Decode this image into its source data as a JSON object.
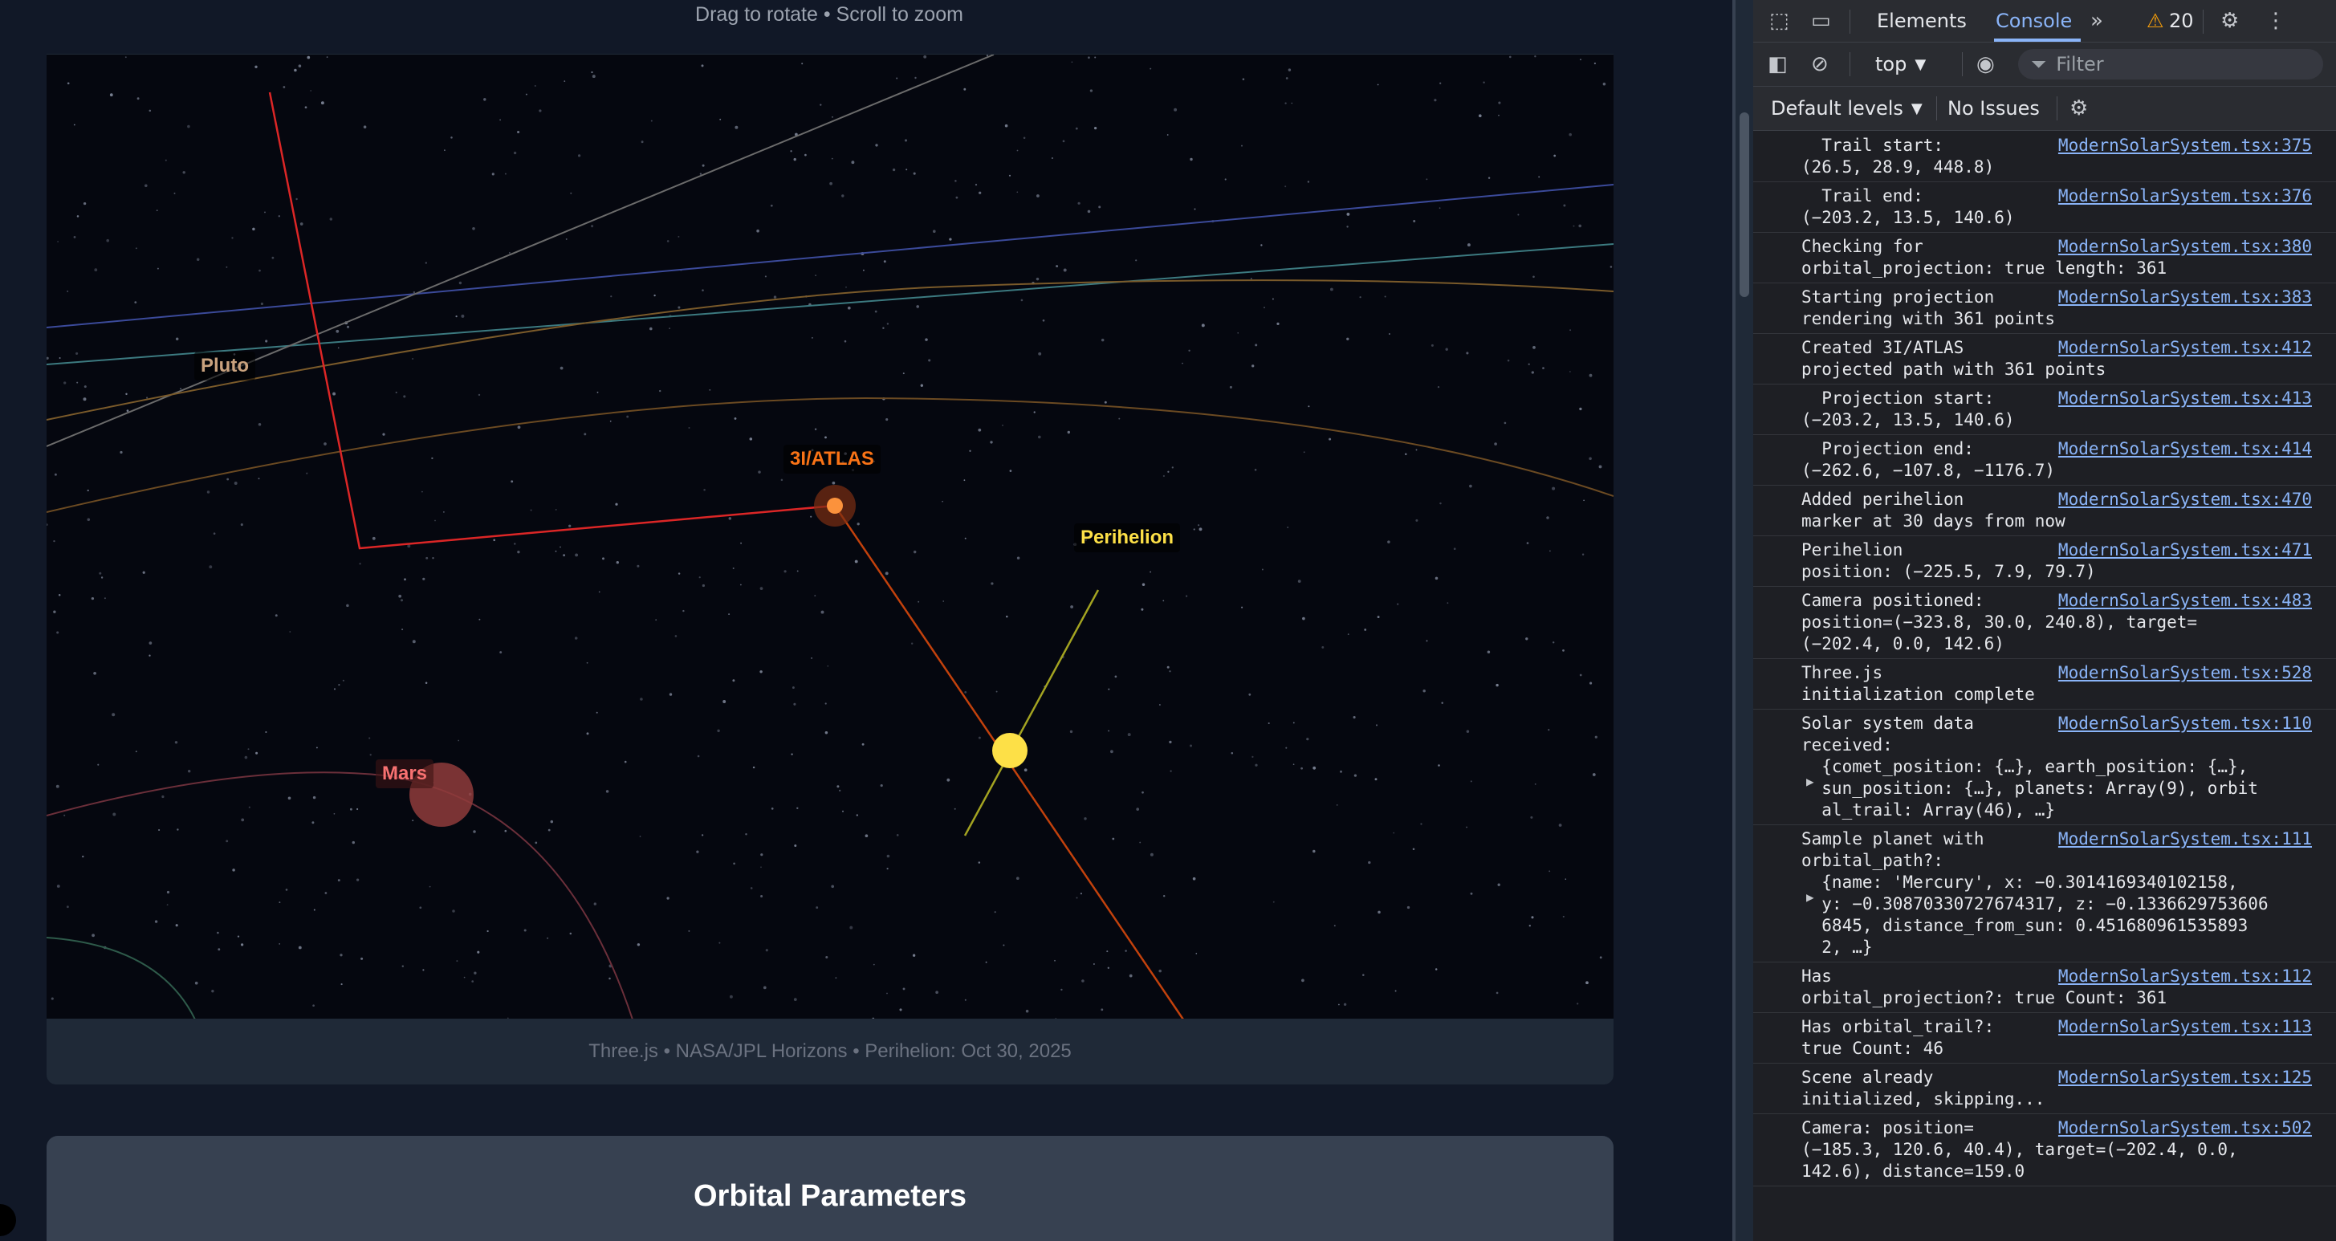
{
  "app": {
    "hint": "Drag to rotate • Scroll to zoom",
    "footer": "Three.js • NASA/JPL Horizons • Perihelion: Oct 30, 2025",
    "section_title": "Orbital Parameters",
    "labels": {
      "pluto": "Pluto",
      "atlas": "3I/ATLAS",
      "perihelion": "Perihelion",
      "mars": "Mars"
    },
    "colors": {
      "atlas": "#f97316",
      "perihelion": "#facc15",
      "mars": "#ef4444",
      "sun": "#fde047",
      "trail": "#dc2626"
    }
  },
  "devtools": {
    "tabs": {
      "elements": "Elements",
      "console": "Console"
    },
    "warning_count": "20",
    "context": "top",
    "filter_placeholder": "Filter",
    "levels": "Default levels",
    "issues": "No Issues",
    "icons": [
      "inspect-icon",
      "device-toolbar-icon",
      "more-tabs-icon",
      "warning-icon",
      "settings-icon",
      "kebab-menu-icon",
      "sidebar-toggle-icon",
      "clear-console-icon",
      "eye-icon",
      "filter-icon",
      "console-settings-icon"
    ],
    "logs": [
      {
        "text": "  Trail start:\n(26.5, 28.9, 448.8)",
        "src": "ModernSolarSystem.tsx:375"
      },
      {
        "text": "  Trail end:\n(−203.2, 13.5, 140.6)",
        "src": "ModernSolarSystem.tsx:376"
      },
      {
        "text": "Checking for\norbital_projection: true length: 361",
        "src": "ModernSolarSystem.tsx:380"
      },
      {
        "text": "Starting projection\nrendering with 361 points",
        "src": "ModernSolarSystem.tsx:383"
      },
      {
        "text": "Created 3I/ATLAS\nprojected path with 361 points",
        "src": "ModernSolarSystem.tsx:412"
      },
      {
        "text": "  Projection start:\n(−203.2, 13.5, 140.6)",
        "src": "ModernSolarSystem.tsx:413"
      },
      {
        "text": "  Projection end:\n(−262.6, −107.8, −1176.7)",
        "src": "ModernSolarSystem.tsx:414"
      },
      {
        "text": "Added perihelion\nmarker at 30 days from now",
        "src": "ModernSolarSystem.tsx:470"
      },
      {
        "text": "Perihelion\nposition: (−225.5, 7.9, 79.7)",
        "src": "ModernSolarSystem.tsx:471"
      },
      {
        "text": "Camera positioned:\nposition=(−323.8, 30.0, 240.8), target=\n(−202.4, 0.0, 142.6)",
        "src": "ModernSolarSystem.tsx:483"
      },
      {
        "text": "Three.js\ninitialization complete",
        "src": "ModernSolarSystem.tsx:528"
      },
      {
        "text": "Solar system data\nreceived:\n  {comet_position: {…}, earth_position: {…},\n  sun_position: {…}, planets: Array(9), orbit\n  al_trail: Array(46), …}",
        "src": "ModernSolarSystem.tsx:110"
      },
      {
        "text": "Sample planet with\norbital_path?:\n  {name: 'Mercury', x: −0.3014169340102158,\n  y: −0.30870330727674317, z: −0.1336629753606\n  6845, distance_from_sun: 0.451680961535893\n  2, …}",
        "src": "ModernSolarSystem.tsx:111"
      },
      {
        "text": "Has\norbital_projection?: true Count: 361",
        "src": "ModernSolarSystem.tsx:112"
      },
      {
        "text": "Has orbital_trail?:\ntrue Count: 46",
        "src": "ModernSolarSystem.tsx:113"
      },
      {
        "text": "Scene already\ninitialized, skipping...",
        "src": "ModernSolarSystem.tsx:125"
      },
      {
        "text": "Camera: position=\n(−185.3, 120.6, 40.4), target=(−202.4, 0.0,\n142.6), distance=159.0",
        "src": "ModernSolarSystem.tsx:502"
      }
    ]
  }
}
